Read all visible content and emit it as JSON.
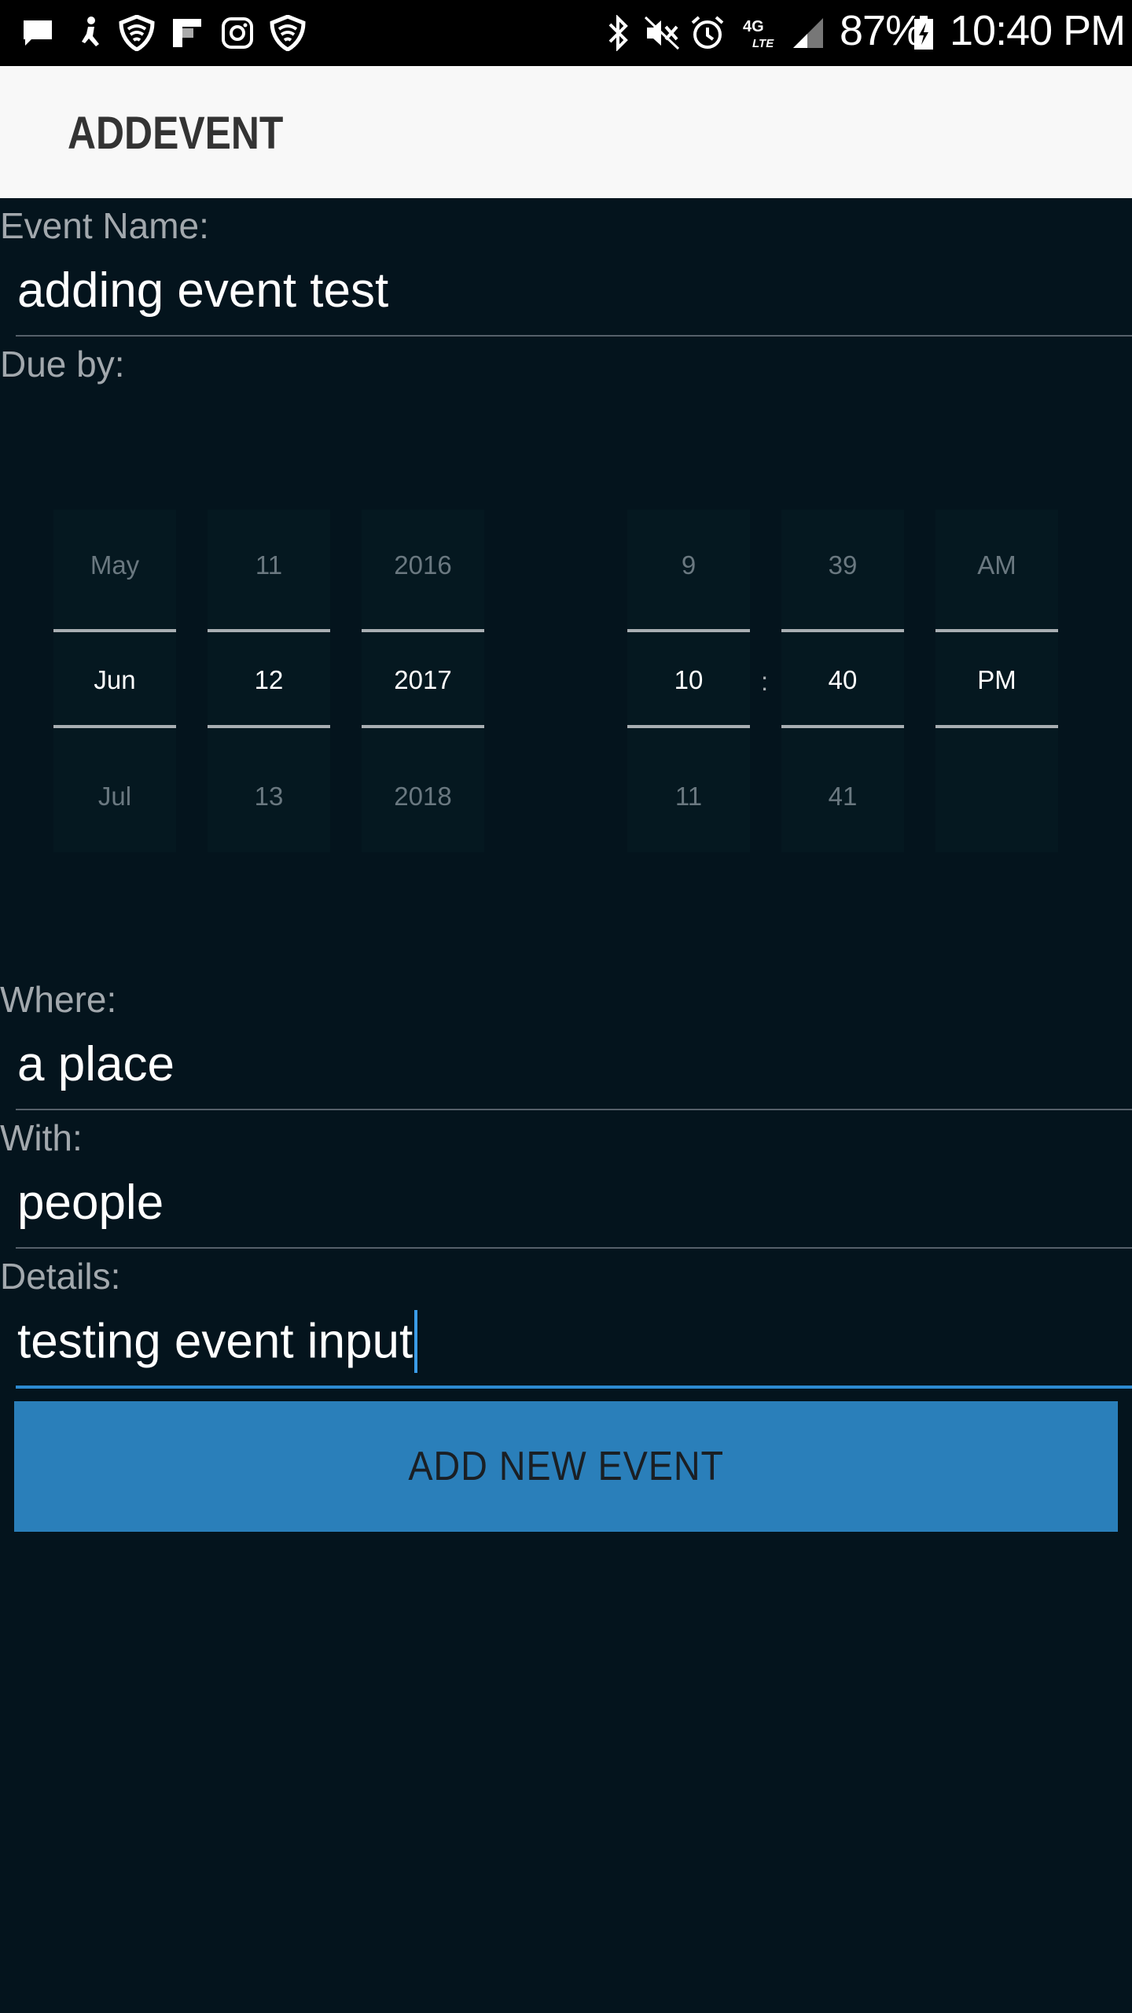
{
  "status_bar": {
    "battery": "87%",
    "time": "10:40 PM",
    "network": "4G LTE",
    "left_icons": [
      "message-icon",
      "accessibility-icon",
      "shield-icon",
      "flipboard-icon",
      "instagram-icon",
      "shield-icon"
    ],
    "right_icons": [
      "bluetooth-icon",
      "mute-icon",
      "alarm-icon",
      "lte-icon",
      "signal-icon",
      "battery-charging-icon"
    ]
  },
  "app_bar": {
    "title": "ADDEVENT"
  },
  "form": {
    "event_name": {
      "label": "Event Name:",
      "value": "adding event test"
    },
    "due_by": {
      "label": "Due by:"
    },
    "where": {
      "label": "Where:",
      "value": "a place"
    },
    "with": {
      "label": "With:",
      "value": "people"
    },
    "details": {
      "label": "Details:",
      "value": "testing event input"
    }
  },
  "date_picker": {
    "month": {
      "prev": "May",
      "selected": "Jun",
      "next": "Jul"
    },
    "day": {
      "prev": "11",
      "selected": "12",
      "next": "13"
    },
    "year": {
      "prev": "2016",
      "selected": "2017",
      "next": "2018"
    }
  },
  "time_picker": {
    "hour": {
      "prev": "9",
      "selected": "10",
      "next": "11"
    },
    "separator": ":",
    "minute": {
      "prev": "39",
      "selected": "40",
      "next": "41"
    },
    "ampm": {
      "prev": "AM",
      "selected": "PM",
      "next": ""
    }
  },
  "button": {
    "label": "ADD NEW EVENT"
  },
  "colors": {
    "background": "#04141d",
    "accent": "#2a7fba",
    "focus": "#2d8ad0",
    "app_bar": "#f8f8f8"
  }
}
